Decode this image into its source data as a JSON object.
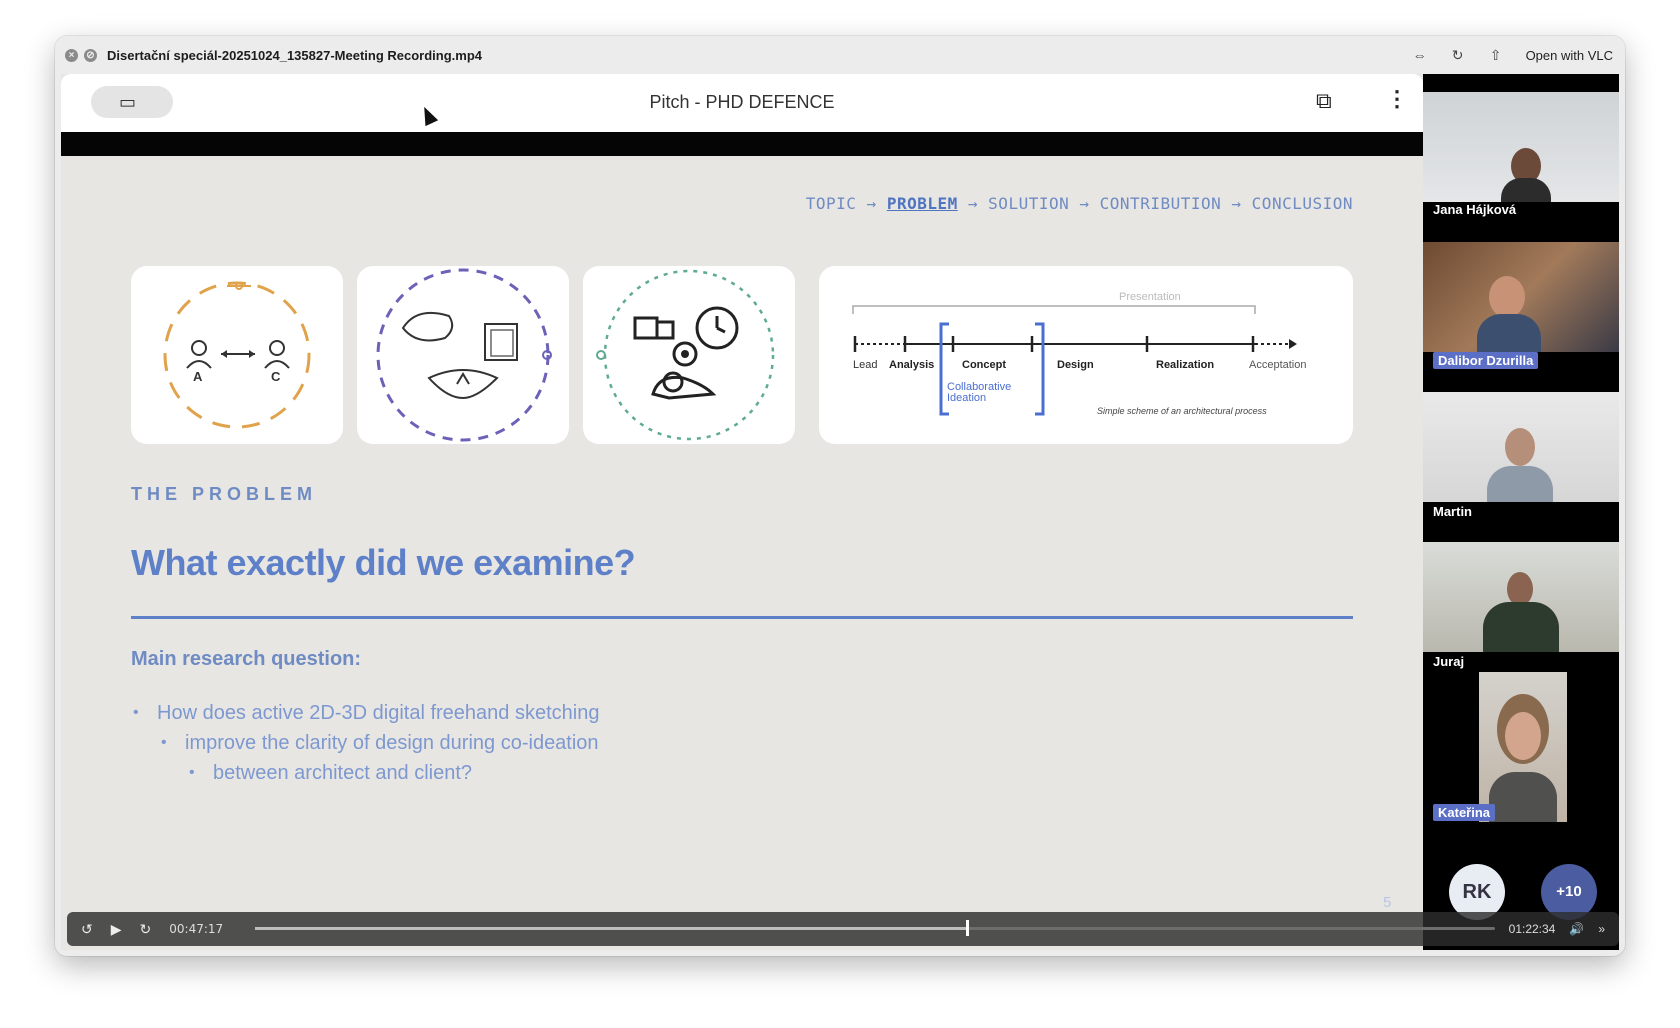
{
  "window": {
    "title": "Disertační speciál-20251024_135827-Meeting Recording.mp4",
    "open_with": "Open with VLC"
  },
  "presentation": {
    "title": "Pitch - PHD DEFENCE"
  },
  "slide": {
    "breadcrumb": [
      "TOPIC",
      "PROBLEM",
      "SOLUTION",
      "CONTRIBUTION",
      "CONCLUSION"
    ],
    "arrow": "→",
    "section_label": "THE PROBLEM",
    "heading": "What exactly did we examine?",
    "subheading": "Main research question:",
    "bullets": [
      "How does active 2D-3D digital freehand sketching",
      "improve the clarity of design during co-ideation",
      "between architect and client?"
    ],
    "page_number": "5",
    "card1": {
      "left_label": "A",
      "right_label": "C"
    },
    "process": {
      "bracket_label": "Presentation",
      "stages": [
        "Lead",
        "Analysis",
        "Concept",
        "Design",
        "Realization",
        "Acceptation"
      ],
      "highlight": "Collaborative Ideation",
      "caption": "Simple scheme of an architectural process"
    }
  },
  "participants": [
    {
      "name": "Jana Hájková"
    },
    {
      "name": "Dalibor Dzurilla"
    },
    {
      "name": "Martin"
    },
    {
      "name": "Juraj"
    },
    {
      "name": "Kateřina"
    }
  ],
  "avatars": {
    "initials": "RK",
    "more": "+10"
  },
  "player": {
    "current_time": "00:47:17",
    "total_time": "01:22:34",
    "progress": 0.573
  },
  "colors": {
    "accent_blue": "#5e80c8",
    "orange": "#e0a24a",
    "purple": "#6b62b8",
    "teal": "#5faa92",
    "slide_bg": "#e8e6e3"
  }
}
